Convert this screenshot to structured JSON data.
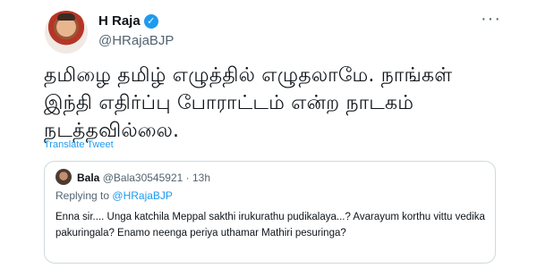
{
  "tweet": {
    "author_name": "H Raja",
    "author_handle": "@HRajaBJP",
    "verified_mark": "✓",
    "more_label": "···",
    "text": "தமிழை தமிழ் எழுத்தில் எழுதலாமே. நாங்கள் இந்தி எதிர்ப்பு போராட்டம் என்ற நாடகம் நடத்தவில்லை.",
    "translate_label": "Translate Tweet"
  },
  "quoted": {
    "author_name": "Bala",
    "author_handle": "@Bala30545921",
    "separator": "·",
    "time": "13h",
    "replying_prefix": "Replying to",
    "replying_to": "@HRajaBJP",
    "text": "Enna sir.... Unga katchila Meppal sakthi irukurathu pudikalaya...? Avarayum korthu vittu vedika pakuringala? Enamo neenga periya uthamar Mathiri pesuringa?"
  },
  "colors": {
    "accent": "#1d9bf0",
    "secondary_text": "#536471",
    "border": "#cfd9de"
  }
}
